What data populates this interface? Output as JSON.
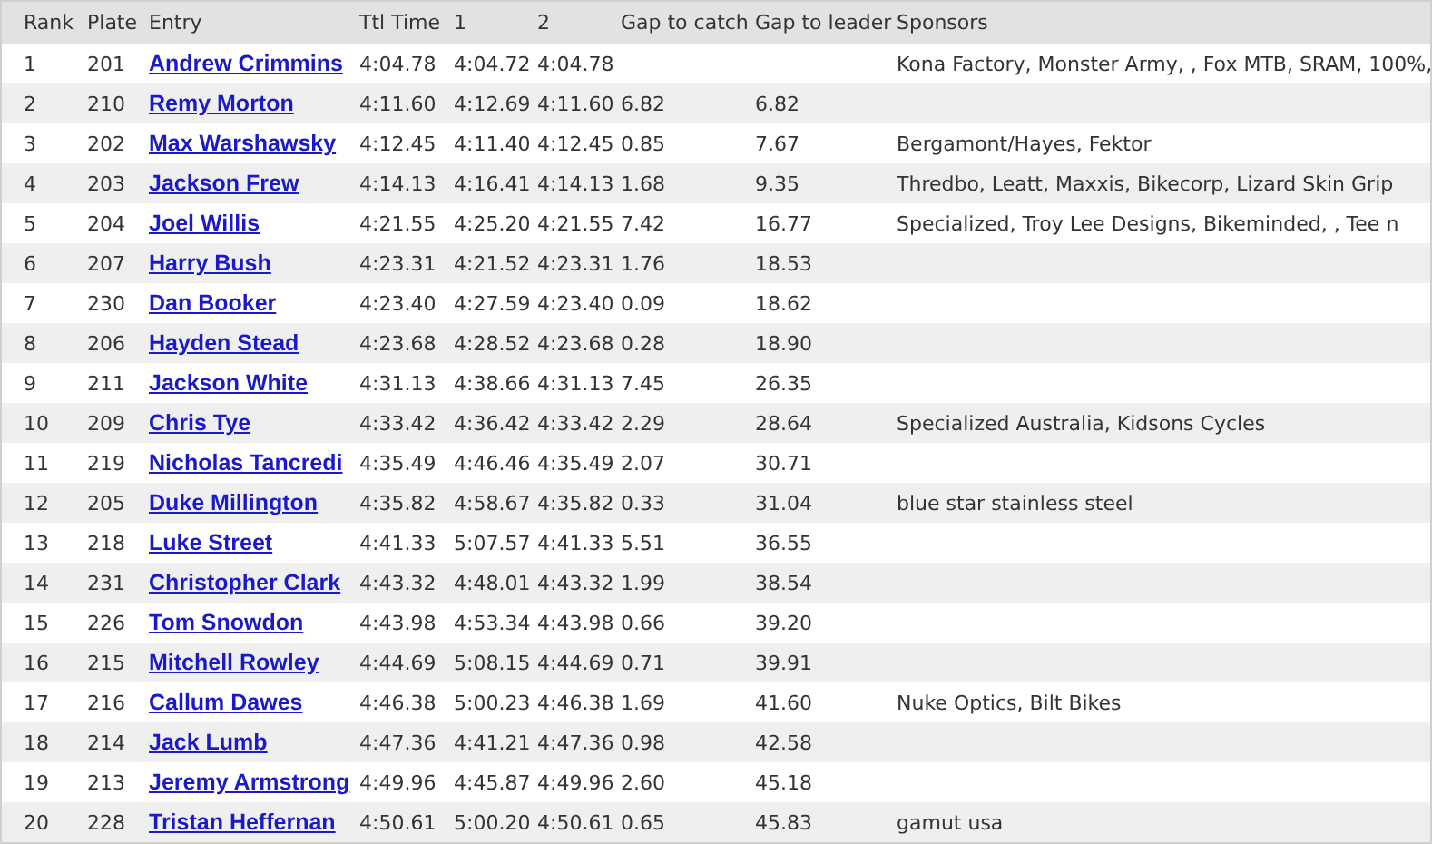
{
  "table": {
    "columns": [
      "Rank",
      "Plate",
      "Entry",
      "Ttl Time",
      "1",
      "2",
      "Gap to catch",
      "Gap to leader",
      "Sponsors"
    ],
    "rows": [
      {
        "rank": "1",
        "plate": "201",
        "entry": "Andrew Crimmins",
        "ttl_time": "4:04.78",
        "lap_1": "4:04.72",
        "lap_2": "4:04.78",
        "sponsors": "Kona Factory, Monster Army, , Fox MTB, SRAM, 100%,"
      },
      {
        "rank": "2",
        "plate": "210",
        "entry": "Remy Morton",
        "ttl_time": "4:11.60",
        "lap_1": "4:12.69",
        "lap_2": "4:11.60",
        "gap_to_catch": "6.82",
        "gap_to_leader": "6.82"
      },
      {
        "rank": "3",
        "plate": "202",
        "entry": "Max Warshawsky",
        "ttl_time": "4:12.45",
        "lap_1": "4:11.40",
        "lap_2": "4:12.45",
        "gap_to_catch": "0.85",
        "gap_to_leader": "7.67",
        "sponsors": "Bergamont/Hayes, Fektor"
      },
      {
        "rank": "4",
        "plate": "203",
        "entry": "Jackson Frew",
        "ttl_time": "4:14.13",
        "lap_1": "4:16.41",
        "lap_2": "4:14.13",
        "gap_to_catch": "1.68",
        "gap_to_leader": "9.35",
        "sponsors": "Thredbo, Leatt, Maxxis, Bikecorp, Lizard Skin Grip"
      },
      {
        "rank": "5",
        "plate": "204",
        "entry": "Joel Willis",
        "ttl_time": "4:21.55",
        "lap_1": "4:25.20",
        "lap_2": "4:21.55",
        "gap_to_catch": "7.42",
        "gap_to_leader": "16.77",
        "sponsors": "Specialized, Troy Lee Designs, Bikeminded, , Tee n"
      },
      {
        "rank": "6",
        "plate": "207",
        "entry": "Harry Bush",
        "ttl_time": "4:23.31",
        "lap_1": "4:21.52",
        "lap_2": "4:23.31",
        "gap_to_catch": "1.76",
        "gap_to_leader": "18.53"
      },
      {
        "rank": "7",
        "plate": "230",
        "entry": "Dan Booker",
        "ttl_time": "4:23.40",
        "lap_1": "4:27.59",
        "lap_2": "4:23.40",
        "gap_to_catch": "0.09",
        "gap_to_leader": "18.62"
      },
      {
        "rank": "8",
        "plate": "206",
        "entry": "Hayden Stead",
        "ttl_time": "4:23.68",
        "lap_1": "4:28.52",
        "lap_2": "4:23.68",
        "gap_to_catch": "0.28",
        "gap_to_leader": "18.90"
      },
      {
        "rank": "9",
        "plate": "211",
        "entry": "Jackson White",
        "ttl_time": "4:31.13",
        "lap_1": "4:38.66",
        "lap_2": "4:31.13",
        "gap_to_catch": "7.45",
        "gap_to_leader": "26.35"
      },
      {
        "rank": "10",
        "plate": "209",
        "entry": "Chris Tye",
        "ttl_time": "4:33.42",
        "lap_1": "4:36.42",
        "lap_2": "4:33.42",
        "gap_to_catch": "2.29",
        "gap_to_leader": "28.64",
        "sponsors": "Specialized Australia, Kidsons Cycles"
      },
      {
        "rank": "11",
        "plate": "219",
        "entry": "Nicholas Tancredi",
        "ttl_time": "4:35.49",
        "lap_1": "4:46.46",
        "lap_2": "4:35.49",
        "gap_to_catch": "2.07",
        "gap_to_leader": "30.71"
      },
      {
        "rank": "12",
        "plate": "205",
        "entry": "Duke Millington",
        "ttl_time": "4:35.82",
        "lap_1": "4:58.67",
        "lap_2": "4:35.82",
        "gap_to_catch": "0.33",
        "gap_to_leader": "31.04",
        "sponsors": "blue star stainless steel"
      },
      {
        "rank": "13",
        "plate": "218",
        "entry": "Luke Street",
        "ttl_time": "4:41.33",
        "lap_1": "5:07.57",
        "lap_2": "4:41.33",
        "gap_to_catch": "5.51",
        "gap_to_leader": "36.55"
      },
      {
        "rank": "14",
        "plate": "231",
        "entry": "Christopher Clark",
        "ttl_time": "4:43.32",
        "lap_1": "4:48.01",
        "lap_2": "4:43.32",
        "gap_to_catch": "1.99",
        "gap_to_leader": "38.54"
      },
      {
        "rank": "15",
        "plate": "226",
        "entry": "Tom Snowdon",
        "ttl_time": "4:43.98",
        "lap_1": "4:53.34",
        "lap_2": "4:43.98",
        "gap_to_catch": "0.66",
        "gap_to_leader": "39.20"
      },
      {
        "rank": "16",
        "plate": "215",
        "entry": "Mitchell Rowley",
        "ttl_time": "4:44.69",
        "lap_1": "5:08.15",
        "lap_2": "4:44.69",
        "gap_to_catch": "0.71",
        "gap_to_leader": "39.91"
      },
      {
        "rank": "17",
        "plate": "216",
        "entry": "Callum Dawes",
        "ttl_time": "4:46.38",
        "lap_1": "5:00.23",
        "lap_2": "4:46.38",
        "gap_to_catch": "1.69",
        "gap_to_leader": "41.60",
        "sponsors": "Nuke Optics, Bilt Bikes"
      },
      {
        "rank": "18",
        "plate": "214",
        "entry": "Jack Lumb",
        "ttl_time": "4:47.36",
        "lap_1": "4:41.21",
        "lap_2": "4:47.36",
        "gap_to_catch": "0.98",
        "gap_to_leader": "42.58"
      },
      {
        "rank": "19",
        "plate": "213",
        "entry": "Jeremy Armstrong",
        "ttl_time": "4:49.96",
        "lap_1": "4:45.87",
        "lap_2": "4:49.96",
        "gap_to_catch": "2.60",
        "gap_to_leader": "45.18"
      },
      {
        "rank": "20",
        "plate": "228",
        "entry": "Tristan Heffernan",
        "ttl_time": "4:50.61",
        "lap_1": "5:00.20",
        "lap_2": "4:50.61",
        "gap_to_catch": "0.65",
        "gap_to_leader": "45.83",
        "sponsors": "gamut usa"
      }
    ]
  }
}
